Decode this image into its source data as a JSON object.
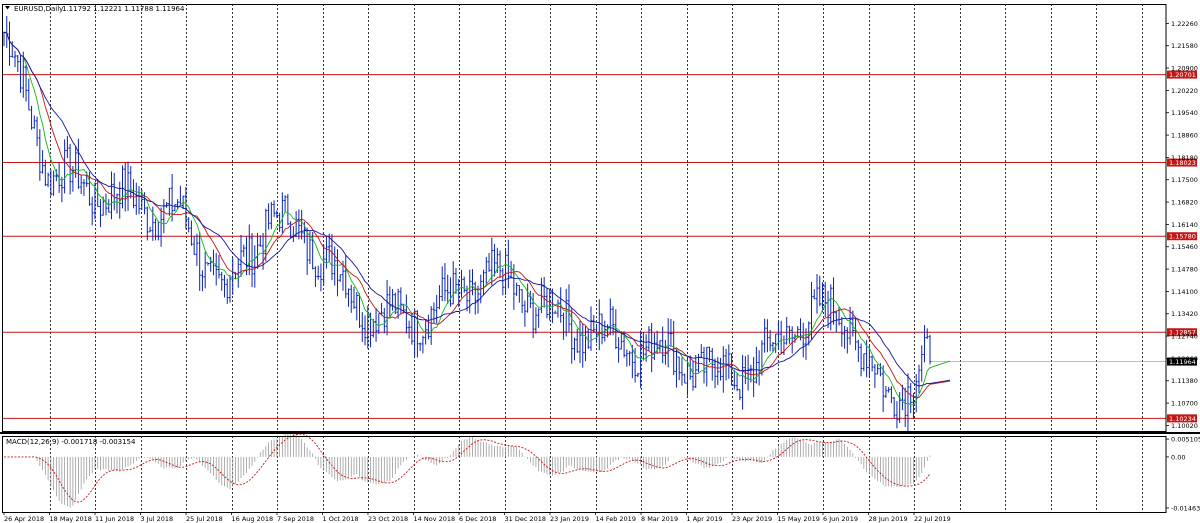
{
  "header": {
    "symbol_label": "EURUSD,Daily",
    "ohlc": "1.11792 1.12221 1.11788 1.11964"
  },
  "macd": {
    "label": "MACD(12,26,9) -0.001718 -0.003154"
  },
  "chart_data": {
    "type": "candlestick",
    "symbol": "EURUSD",
    "timeframe": "Daily",
    "price_ticks": [
      "1.22260",
      "1.21580",
      "1.20900",
      "1.20220",
      "1.19540",
      "1.18860",
      "1.18180",
      "1.17500",
      "1.16820",
      "1.16140",
      "1.15460",
      "1.14780",
      "1.14100",
      "1.13420",
      "1.12740",
      "1.12060",
      "1.11380",
      "1.10700",
      "1.10020"
    ],
    "ylim": [
      1.0985,
      1.2285
    ],
    "horizontal_levels": [
      {
        "label": "1.20701",
        "value": 1.20701
      },
      {
        "label": "1.18023",
        "value": 1.18023
      },
      {
        "label": "1.15780",
        "value": 1.1578
      },
      {
        "label": "1.12857",
        "value": 1.12857
      },
      {
        "label": "1.10234",
        "value": 1.10234
      }
    ],
    "current_price": {
      "label": "1.11964",
      "value": 1.11964
    },
    "date_ticks": [
      "26 Apr 2018",
      "18 May 2018",
      "11 Jun 2018",
      "3 Jul 2018",
      "25 Jul 2018",
      "16 Aug 2018",
      "7 Sep 2018",
      "1 Oct 2018",
      "23 Oct 2018",
      "14 Nov 2018",
      "6 Dec 2018",
      "31 Dec 2018",
      "23 Jan 2019",
      "14 Feb 2019",
      "8 Mar 2019",
      "1 Apr 2019",
      "23 Apr 2019",
      "15 May 2019",
      "6 Jun 2019",
      "28 Jun 2019",
      "22 Jul 2019"
    ],
    "close_path": [
      {
        "date": "26 Apr 2018",
        "close": 1.22
      },
      {
        "date": "18 May 2018",
        "close": 1.178
      },
      {
        "date": "11 Jun 2018",
        "close": 1.172
      },
      {
        "date": "3 Jul 2018",
        "close": 1.168
      },
      {
        "date": "25 Jul 2018",
        "close": 1.164
      },
      {
        "date": "16 Aug 2018",
        "close": 1.14
      },
      {
        "date": "7 Sep 2018",
        "close": 1.164
      },
      {
        "date": "1 Oct 2018",
        "close": 1.156
      },
      {
        "date": "23 Oct 2018",
        "close": 1.138
      },
      {
        "date": "14 Nov 2018",
        "close": 1.132
      },
      {
        "date": "6 Dec 2018",
        "close": 1.137
      },
      {
        "date": "31 Dec 2018",
        "close": 1.146
      },
      {
        "date": "23 Jan 2019",
        "close": 1.138
      },
      {
        "date": "14 Feb 2019",
        "close": 1.13
      },
      {
        "date": "8 Mar 2019",
        "close": 1.126
      },
      {
        "date": "1 Apr 2019",
        "close": 1.123
      },
      {
        "date": "23 Apr 2019",
        "close": 1.116
      },
      {
        "date": "15 May 2019",
        "close": 1.117
      },
      {
        "date": "6 Jun 2019",
        "close": 1.132
      },
      {
        "date": "28 Jun 2019",
        "close": 1.136
      },
      {
        "date": "22 Jul 2019",
        "close": 1.108
      },
      {
        "date": "end",
        "close": 1.11964
      }
    ],
    "macd_ticks": [
      "0.005105",
      "0.00",
      "-0.014635"
    ],
    "macd_ylim": [
      -0.0158,
      0.006
    ],
    "series_colors": {
      "price": "#0a23b8",
      "ma_fast": "#16b716",
      "ma_mid": "#c81414",
      "ma_slow": "#1414a0",
      "levels": "#c81414",
      "macd_signal": "#c81414",
      "macd_hist": "#9a9a9a"
    }
  }
}
